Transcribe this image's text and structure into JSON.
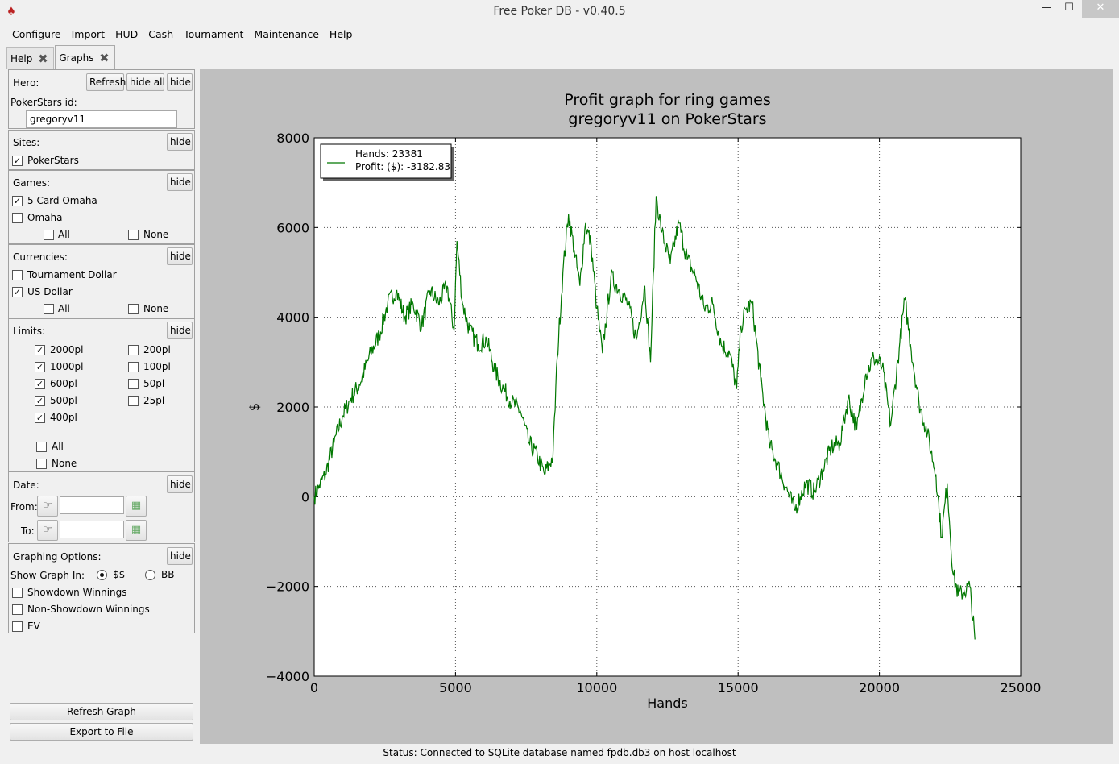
{
  "window": {
    "title": "Free Poker DB - v0.40.5",
    "min_glyph": "—",
    "max_glyph": "☐",
    "close_glyph": "✕"
  },
  "menu": [
    {
      "u": "C",
      "rest": "onfigure"
    },
    {
      "u": "I",
      "rest": "mport"
    },
    {
      "u": "H",
      "rest": "UD"
    },
    {
      "u": "C",
      "rest": "ash"
    },
    {
      "u": "T",
      "rest": "ournament"
    },
    {
      "u": "M",
      "rest": "aintenance"
    },
    {
      "u": "H",
      "rest": "elp"
    }
  ],
  "tabs": [
    {
      "label": "Help",
      "active": false
    },
    {
      "label": "Graphs",
      "active": true
    }
  ],
  "hero": {
    "label": "Hero:",
    "refresh": "Refresh",
    "hide_all": "hide all",
    "hide": "hide",
    "site_id_label": "PokerStars id:",
    "player_value": "gregoryv11"
  },
  "sites": {
    "label": "Sites:",
    "hide": "hide",
    "items": [
      {
        "label": "PokerStars",
        "checked": true
      }
    ]
  },
  "games": {
    "label": "Games:",
    "hide": "hide",
    "items": [
      {
        "label": "5 Card Omaha",
        "checked": true
      },
      {
        "label": "Omaha",
        "checked": false
      }
    ],
    "all": "All",
    "none": "None"
  },
  "currencies": {
    "label": "Currencies:",
    "hide": "hide",
    "items": [
      {
        "label": "Tournament Dollar",
        "checked": false
      },
      {
        "label": "US Dollar",
        "checked": true
      }
    ],
    "all": "All",
    "none": "None"
  },
  "limits": {
    "label": "Limits:",
    "hide": "hide",
    "left": [
      {
        "label": "2000pl",
        "checked": true
      },
      {
        "label": "1000pl",
        "checked": true
      },
      {
        "label": "600pl",
        "checked": true
      },
      {
        "label": "500pl",
        "checked": true
      },
      {
        "label": "400pl",
        "checked": true
      }
    ],
    "right": [
      {
        "label": "200pl",
        "checked": false
      },
      {
        "label": "100pl",
        "checked": false
      },
      {
        "label": "50pl",
        "checked": false
      },
      {
        "label": "25pl",
        "checked": false
      }
    ],
    "all": "All",
    "none": "None"
  },
  "date": {
    "label": "Date:",
    "hide": "hide",
    "from": "From:",
    "to": "To:",
    "from_value": "",
    "to_value": ""
  },
  "graphing": {
    "label": "Graphing Options:",
    "hide": "hide",
    "show_in": "Show Graph In:",
    "dollars": "$$",
    "bb": "BB",
    "selected": "$$",
    "options": [
      {
        "label": "Showdown Winnings",
        "checked": false
      },
      {
        "label": "Non-Showdown Winnings",
        "checked": false
      },
      {
        "label": "EV",
        "checked": false
      }
    ]
  },
  "actions": {
    "refresh_graph": "Refresh Graph",
    "export": "Export to File"
  },
  "status": "Status: Connected to SQLite database named fpdb.db3 on host localhost",
  "chart_data": {
    "type": "line",
    "title": "Profit graph for ring games",
    "subtitle": "gregoryv11 on PokerStars",
    "xlabel": "Hands",
    "ylabel": "$",
    "xlim": [
      0,
      25000
    ],
    "ylim": [
      -4000,
      8000
    ],
    "xticks": [
      0,
      5000,
      10000,
      15000,
      20000,
      25000
    ],
    "yticks": [
      -4000,
      -2000,
      0,
      2000,
      4000,
      6000,
      8000
    ],
    "grid": true,
    "line_color": "#007700",
    "legend_position": "top-left",
    "legend": [
      "Hands: 23381",
      "Profit: ($): -3182.83"
    ],
    "series": [
      {
        "x": [
          0,
          150,
          400,
          700,
          1000,
          1300,
          1600,
          2000,
          2300,
          2600,
          2900,
          3200,
          3500,
          3800,
          4100,
          4400,
          4700,
          4950,
          5050,
          5250,
          5500,
          5800,
          6100,
          6400,
          6700,
          7000,
          7300,
          7600,
          7900,
          8150,
          8450,
          8600,
          8800,
          9000,
          9200,
          9400,
          9600,
          9800,
          10000,
          10200,
          10500,
          10800,
          11100,
          11400,
          11700,
          11900,
          12100,
          12300,
          12600,
          12900,
          13200,
          13500,
          13800,
          14100,
          14400,
          14700,
          14950,
          15100,
          15300,
          15500,
          15800,
          16100,
          16400,
          16700,
          17000,
          17200,
          17400,
          17700,
          18000,
          18300,
          18600,
          18900,
          19200,
          19500,
          19800,
          20100,
          20400,
          20700,
          20900,
          21100,
          21400,
          21700,
          22000,
          22200,
          22400,
          22600,
          22800,
          23000,
          23200,
          23381
        ],
        "y": [
          0,
          200,
          500,
          1200,
          1800,
          2200,
          2500,
          3200,
          3600,
          4300,
          4600,
          4000,
          4300,
          3800,
          4600,
          4300,
          4700,
          3700,
          5700,
          4300,
          3700,
          3400,
          3500,
          2800,
          2400,
          2100,
          1900,
          1200,
          900,
          500,
          900,
          3100,
          5000,
          6300,
          5500,
          4700,
          6100,
          5600,
          4200,
          3200,
          4900,
          4600,
          4300,
          3500,
          4700,
          3000,
          6700,
          5900,
          5200,
          6100,
          5300,
          4900,
          4200,
          4300,
          3400,
          3200,
          2400,
          3800,
          4200,
          4300,
          2600,
          1200,
          700,
          200,
          -300,
          0,
          300,
          100,
          600,
          1100,
          1200,
          2200,
          1500,
          2700,
          3100,
          2900,
          1600,
          3300,
          4400,
          3400,
          2100,
          1400,
          500,
          -900,
          300,
          -1700,
          -2200,
          -2100,
          -2000,
          -3182.83
        ]
      }
    ]
  }
}
